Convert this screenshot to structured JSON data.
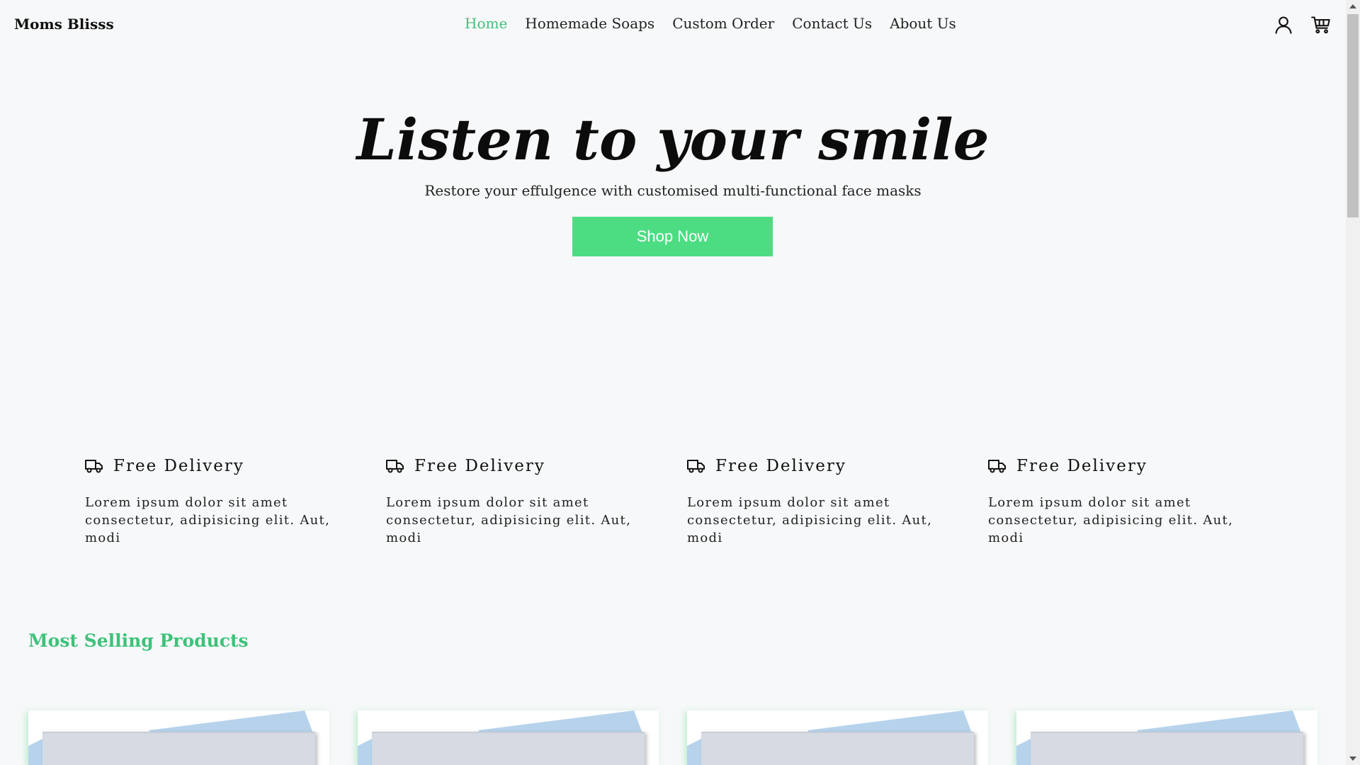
{
  "brand": "Moms Blisss",
  "nav": {
    "items": [
      {
        "label": "Home",
        "active": true
      },
      {
        "label": "Homemade Soaps",
        "active": false
      },
      {
        "label": "Custom Order",
        "active": false
      },
      {
        "label": "Contact Us",
        "active": false
      },
      {
        "label": "About Us",
        "active": false
      }
    ]
  },
  "header_icons": [
    "user-icon",
    "cart-icon"
  ],
  "hero": {
    "title": "Listen to your smile",
    "subtitle": "Restore your effulgence with customised multi-functional face masks",
    "cta": "Shop Now"
  },
  "features": [
    {
      "icon": "truck-icon",
      "title": "Free Delivery",
      "line1": "Lorem ipsum dolor sit amet",
      "line2": "consectetur, adipisicing elit. Aut, modi"
    },
    {
      "icon": "truck-icon",
      "title": "Free Delivery",
      "line1": "Lorem ipsum dolor sit amet",
      "line2": "consectetur, adipisicing elit. Aut, modi"
    },
    {
      "icon": "truck-icon",
      "title": "Free Delivery",
      "line1": "Lorem ipsum dolor sit amet",
      "line2": "consectetur, adipisicing elit. Aut, modi"
    },
    {
      "icon": "truck-icon",
      "title": "Free Delivery",
      "line1": "Lorem ipsum dolor sit amet",
      "line2": "consectetur, adipisicing elit. Aut, modi"
    }
  ],
  "products": {
    "title": "Most Selling Products",
    "count_visible": 4
  },
  "colors": {
    "accent": "#3ec27a",
    "button": "#4cdd82",
    "background": "#f7f8f9"
  }
}
